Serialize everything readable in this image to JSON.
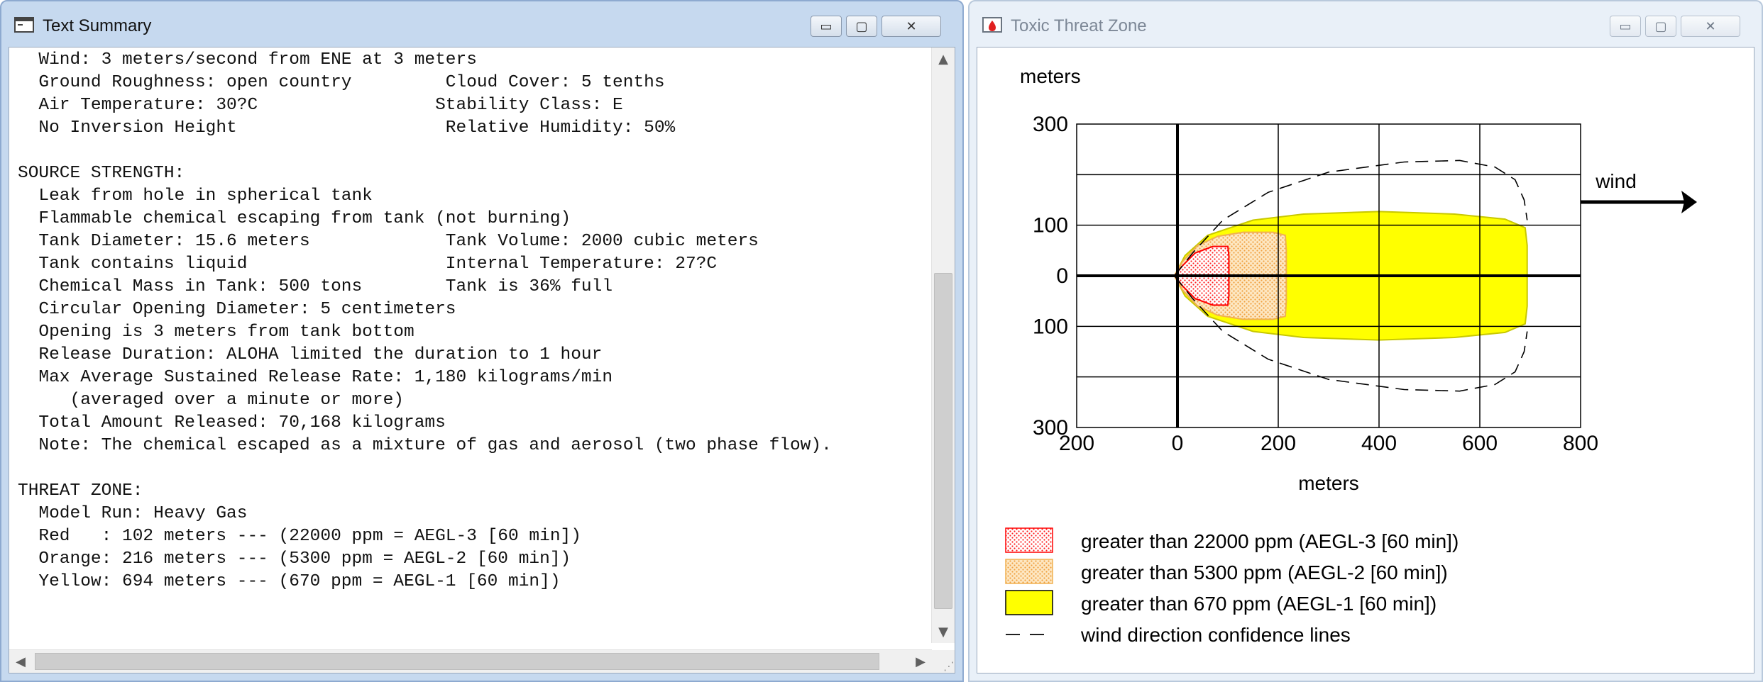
{
  "summary_window": {
    "title": "Text Summary",
    "buttons": {
      "minimize": "▭",
      "maximize": "▢",
      "close": "✕"
    },
    "lines": [
      "  Wind: 3 meters/second from ENE at 3 meters",
      "  Ground Roughness: open country         Cloud Cover: 5 tenths",
      "  Air Temperature: 30?C                 Stability Class: E",
      "  No Inversion Height                    Relative Humidity: 50%",
      "",
      "SOURCE STRENGTH:",
      "  Leak from hole in spherical tank",
      "  Flammable chemical escaping from tank (not burning)",
      "  Tank Diameter: 15.6 meters             Tank Volume: 2000 cubic meters",
      "  Tank contains liquid                   Internal Temperature: 27?C",
      "  Chemical Mass in Tank: 500 tons        Tank is 36% full",
      "  Circular Opening Diameter: 5 centimeters",
      "  Opening is 3 meters from tank bottom",
      "  Release Duration: ALOHA limited the duration to 1 hour",
      "  Max Average Sustained Release Rate: 1,180 kilograms/min",
      "     (averaged over a minute or more)",
      "  Total Amount Released: 70,168 kilograms",
      "  Note: The chemical escaped as a mixture of gas and aerosol (two phase flow).",
      "",
      "THREAT ZONE:",
      "  Model Run: Heavy Gas",
      "  Red   : 102 meters --- (22000 ppm = AEGL-3 [60 min])",
      "  Orange: 216 meters --- (5300 ppm = AEGL-2 [60 min])",
      "  Yellow: 694 meters --- (670 ppm = AEGL-1 [60 min])"
    ]
  },
  "threat_window": {
    "title": "Toxic Threat Zone",
    "buttons": {
      "minimize": "▭",
      "maximize": "▢",
      "close": "✕"
    },
    "wind_label": "wind"
  },
  "chart_data": {
    "type": "area",
    "ylabel": "meters",
    "xlabel": "meters",
    "xlim": [
      -200,
      800
    ],
    "ylim": [
      -300,
      300
    ],
    "x_ticks": [
      200,
      0,
      200,
      400,
      600,
      800
    ],
    "y_ticks": [
      300,
      100,
      0,
      100,
      300
    ],
    "grid": true,
    "zones": [
      {
        "name": "greater than 22000 ppm (AEGL-3 [60 min])",
        "color": "#ff0000",
        "fill": "dotted-red",
        "points": [
          [
            -6,
            0
          ],
          [
            10,
            -20
          ],
          [
            35,
            -45
          ],
          [
            70,
            -58
          ],
          [
            100,
            -58
          ],
          [
            102,
            -40
          ],
          [
            102,
            40
          ],
          [
            100,
            58
          ],
          [
            70,
            58
          ],
          [
            35,
            45
          ],
          [
            10,
            20
          ],
          [
            -6,
            0
          ]
        ]
      },
      {
        "name": "greater than 5300 ppm (AEGL-2 [60 min])",
        "color": "#ffa500",
        "fill": "dotted-orange",
        "points": [
          [
            -6,
            0
          ],
          [
            10,
            -28
          ],
          [
            40,
            -60
          ],
          [
            80,
            -78
          ],
          [
            130,
            -86
          ],
          [
            190,
            -86
          ],
          [
            214,
            -80
          ],
          [
            216,
            -50
          ],
          [
            216,
            50
          ],
          [
            214,
            80
          ],
          [
            190,
            86
          ],
          [
            130,
            86
          ],
          [
            80,
            78
          ],
          [
            40,
            60
          ],
          [
            10,
            28
          ],
          [
            -6,
            0
          ]
        ]
      },
      {
        "name": "greater than 670 ppm (AEGL-1 [60 min])",
        "color": "#ffff00",
        "fill": "solid",
        "points": [
          [
            -6,
            0
          ],
          [
            15,
            -40
          ],
          [
            60,
            -80
          ],
          [
            150,
            -110
          ],
          [
            250,
            -122
          ],
          [
            400,
            -127
          ],
          [
            550,
            -122
          ],
          [
            650,
            -112
          ],
          [
            690,
            -95
          ],
          [
            694,
            -60
          ],
          [
            694,
            60
          ],
          [
            690,
            95
          ],
          [
            650,
            112
          ],
          [
            550,
            122
          ],
          [
            400,
            127
          ],
          [
            250,
            122
          ],
          [
            150,
            110
          ],
          [
            60,
            80
          ],
          [
            15,
            40
          ],
          [
            -6,
            0
          ]
        ]
      }
    ],
    "confidence_lines": {
      "name": "wind direction confidence lines",
      "upper": [
        [
          -6,
          0
        ],
        [
          30,
          -45
        ],
        [
          90,
          -110
        ],
        [
          180,
          -165
        ],
        [
          300,
          -205
        ],
        [
          450,
          -225
        ],
        [
          560,
          -228
        ],
        [
          630,
          -215
        ],
        [
          670,
          -190
        ],
        [
          688,
          -150
        ],
        [
          694,
          -110
        ]
      ],
      "lower": [
        [
          -6,
          0
        ],
        [
          30,
          45
        ],
        [
          90,
          110
        ],
        [
          180,
          165
        ],
        [
          300,
          205
        ],
        [
          450,
          225
        ],
        [
          560,
          228
        ],
        [
          630,
          215
        ],
        [
          670,
          190
        ],
        [
          688,
          150
        ],
        [
          694,
          110
        ]
      ]
    },
    "legend": {
      "placement": "bottom",
      "entries": [
        "greater than 22000 ppm (AEGL-3 [60 min])",
        "greater than 5300 ppm (AEGL-2 [60 min])",
        "greater than 670 ppm (AEGL-1 [60 min])",
        "wind direction confidence lines"
      ]
    }
  }
}
